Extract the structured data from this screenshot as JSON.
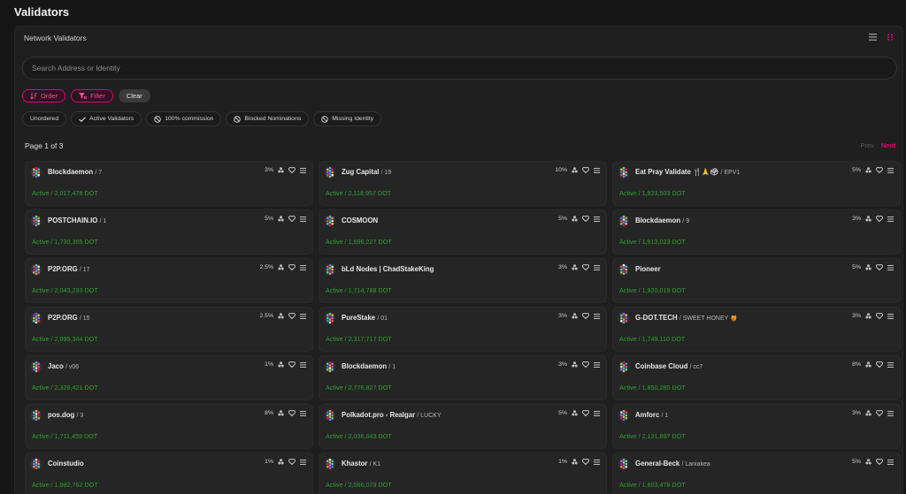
{
  "page": {
    "title": "Validators"
  },
  "panel": {
    "title": "Network Validators"
  },
  "search": {
    "placeholder": "Search Address or Identity"
  },
  "controls": {
    "order": "Order",
    "filter": "Filter",
    "clear": "Clear"
  },
  "filters": [
    {
      "label": "Unordered",
      "icon": ""
    },
    {
      "label": "Active Validators",
      "icon": "check-icon"
    },
    {
      "label": "100% commission",
      "icon": "block-icon"
    },
    {
      "label": "Blocked Nominations",
      "icon": "block-icon"
    },
    {
      "label": "Missing Identity",
      "icon": "block-icon"
    }
  ],
  "pagination": {
    "info": "Page 1 of 3",
    "prev": "Prev",
    "next": "Next"
  },
  "colors": {
    "accent": "#e6007a",
    "active": "#2fa02f"
  },
  "validators": [
    {
      "name": "Blockdaemon",
      "sub": "/ 7",
      "commission": "3%",
      "status": "Active / 2,017,478 DOT"
    },
    {
      "name": "Zug Capital",
      "sub": "/ 19",
      "commission": "10%",
      "status": "Active / 2,118,957 DOT"
    },
    {
      "name": "Eat Pray Validate 🍴🙏🗳",
      "sub": "/ EPV1",
      "commission": "5%",
      "status": "Active / 1,923,503 DOT"
    },
    {
      "name": "POSTCHAIN.IO",
      "sub": "/ 1",
      "commission": "5%",
      "status": "Active / 1,730,365 DOT"
    },
    {
      "name": "COSMOON",
      "sub": "",
      "commission": "5%",
      "status": "Active / 1,696,227 DOT"
    },
    {
      "name": "Blockdaemon",
      "sub": "/ 9",
      "commission": "3%",
      "status": "Active / 1,913,023 DOT"
    },
    {
      "name": "P2P.ORG",
      "sub": "/ 17",
      "commission": "2.5%",
      "status": "Active / 2,043,233 DOT"
    },
    {
      "name": "bLd Nodes | ChadStakeKing",
      "sub": "",
      "commission": "3%",
      "status": "Active / 1,714,788 DOT"
    },
    {
      "name": "Pioneer",
      "sub": "",
      "commission": "5%",
      "status": "Active / 1,920,019 DOT"
    },
    {
      "name": "P2P.ORG",
      "sub": "/ 15",
      "commission": "2.5%",
      "status": "Active / 2,095,344 DOT"
    },
    {
      "name": "PureStake",
      "sub": "/ 01",
      "commission": "3%",
      "status": "Active / 2,317,717 DOT"
    },
    {
      "name": "G-DOT.TECH",
      "sub": "/ SWEET HONEY 🍯",
      "commission": "3%",
      "status": "Active / 1,749,110 DOT"
    },
    {
      "name": "Jaco",
      "sub": "/ v06",
      "commission": "1%",
      "status": "Active / 2,328,421 DOT"
    },
    {
      "name": "Blockdaemon",
      "sub": "/ 1",
      "commission": "3%",
      "status": "Active / 2,776,827 DOT"
    },
    {
      "name": "Coinbase Cloud",
      "sub": "/ cc7",
      "commission": "8%",
      "status": "Active / 1,850,280 DOT"
    },
    {
      "name": "pos.dog",
      "sub": "/ 3",
      "commission": "8%",
      "status": "Active / 1,711,459 DOT"
    },
    {
      "name": "Polkadot.pro - Realgar",
      "sub": "/ LUCKY",
      "commission": "5%",
      "status": "Active / 2,036,843 DOT"
    },
    {
      "name": "Amforc",
      "sub": "/ 1",
      "commission": "3%",
      "status": "Active / 2,131,897 DOT"
    },
    {
      "name": "Coinstudio",
      "sub": "",
      "commission": "1%",
      "status": "Active / 1,882,762 DOT"
    },
    {
      "name": "Khastor",
      "sub": "/ K1",
      "commission": "1%",
      "status": "Active / 2,066,079 DOT"
    },
    {
      "name": "General-Beck",
      "sub": "/ Laniakea",
      "commission": "5%",
      "status": "Active / 1,603,478 DOT"
    }
  ]
}
